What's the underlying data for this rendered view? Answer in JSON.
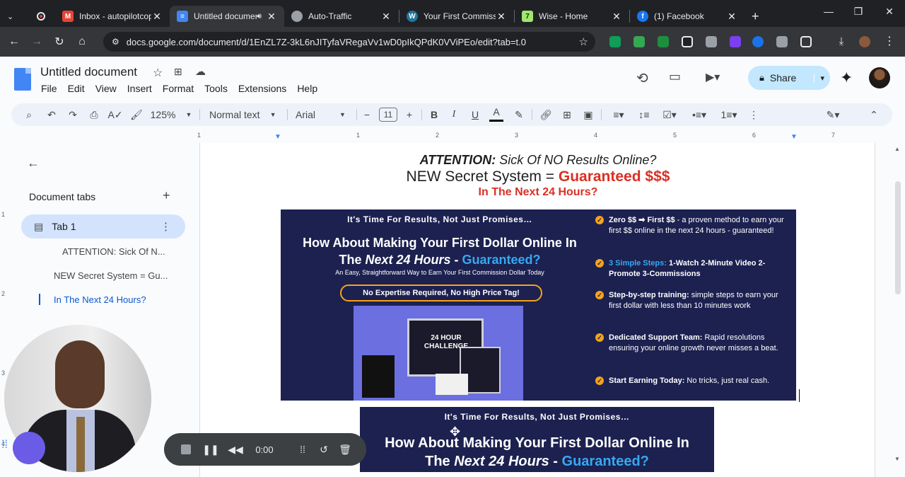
{
  "browser": {
    "tabs": [
      {
        "title": "Inbox - autopilotcop",
        "icon": "gmail-icon",
        "color": "#ea4335"
      },
      {
        "title": "Untitled documen",
        "icon": "docs-icon",
        "color": "#4285f4"
      },
      {
        "title": "Auto-Traffic",
        "icon": "globe-icon",
        "color": "#9aa0a6"
      },
      {
        "title": "Your First Commissio",
        "icon": "wordpress-icon",
        "color": "#21759b"
      },
      {
        "title": "Wise - Home",
        "icon": "wise-icon",
        "color": "#9fe870"
      },
      {
        "title": "(1) Facebook",
        "icon": "facebook-icon",
        "color": "#1877f2"
      }
    ],
    "url": "docs.google.com/document/d/1EnZL7Z-3kL6nJITyfaVRegaVv1wD0pIkQPdK0VViPEo/edit?tab=t.0"
  },
  "docs": {
    "title": "Untitled document",
    "menu": [
      "File",
      "Edit",
      "View",
      "Insert",
      "Format",
      "Tools",
      "Extensions",
      "Help"
    ],
    "share_label": "Share",
    "toolbar": {
      "zoom": "125%",
      "style": "Normal text",
      "font": "Arial",
      "font_size": "11",
      "bold": "B",
      "italic": "I",
      "underline": "U",
      "text_color": "A"
    },
    "ruler_ticks": [
      "1",
      "1",
      "2",
      "3",
      "4",
      "5",
      "6",
      "7"
    ],
    "vruler_ticks": [
      "1",
      "2",
      "3",
      "4"
    ]
  },
  "sidebar": {
    "heading": "Document tabs",
    "add": "+",
    "tab_label": "Tab 1",
    "outline": [
      "ATTENTION: Sick Of N...",
      "NEW Secret System = Gu...",
      "In The Next 24 Hours?"
    ]
  },
  "document": {
    "line1_bold": "ATTENTION:",
    "line1_rest": " Sick Of NO Results Online?",
    "line2_normal": "NEW Secret System = ",
    "line2_red": "Guaranteed $$$",
    "line3": "In The Next 24 Hours?",
    "banner": {
      "tagline": "It's Time For Results, Not Just Promises…",
      "headline_a": "How About Making Your First Dollar Online In",
      "headline_b_pre": "The ",
      "headline_b_em": "Next 24 Hours",
      "headline_b_mid": " - ",
      "headline_b_blue": "Guaranteed?",
      "subline": "An Easy, Straightforward Way to Earn Your First Commission Dollar Today",
      "pill": "No Expertise Required, No High Price Tag!",
      "product_label": "24 HOUR CHALLENGE",
      "bullets": [
        {
          "bold": "Zero $$ ➡ First $$",
          "text": " - a proven method to earn your first $$ online in the next 24 hours - guaranteed!"
        },
        {
          "bold": "3 Simple Steps:",
          "text": " 1-Watch 2-Minute Video 2-Promote 3-Commissions"
        },
        {
          "bold": "Step-by-step training:",
          "text": " simple steps to earn your first dollar with less than 10 minutes work"
        },
        {
          "bold": "Dedicated Support Team:",
          "text": " Rapid resolutions ensuring your online growth never misses a beat."
        },
        {
          "bold": "Start Earning Today:",
          "text": " No tricks, just real cash."
        }
      ]
    },
    "banner2": {
      "tagline": "It's Time For Results, Not Just Promises…",
      "headline_a": "How About Making Your First Dollar Online In",
      "headline_b_pre": "The ",
      "headline_b_em": "Next 24 Hours",
      "headline_b_mid": " - ",
      "headline_b_blue": "Guaranteed?"
    }
  },
  "recorder": {
    "time": "0:00"
  },
  "colors": {
    "accent_red": "#d93025",
    "banner_bg": "#1c2150",
    "guarantee_blue": "#36a9f0",
    "pill_border": "#f6a31a"
  }
}
